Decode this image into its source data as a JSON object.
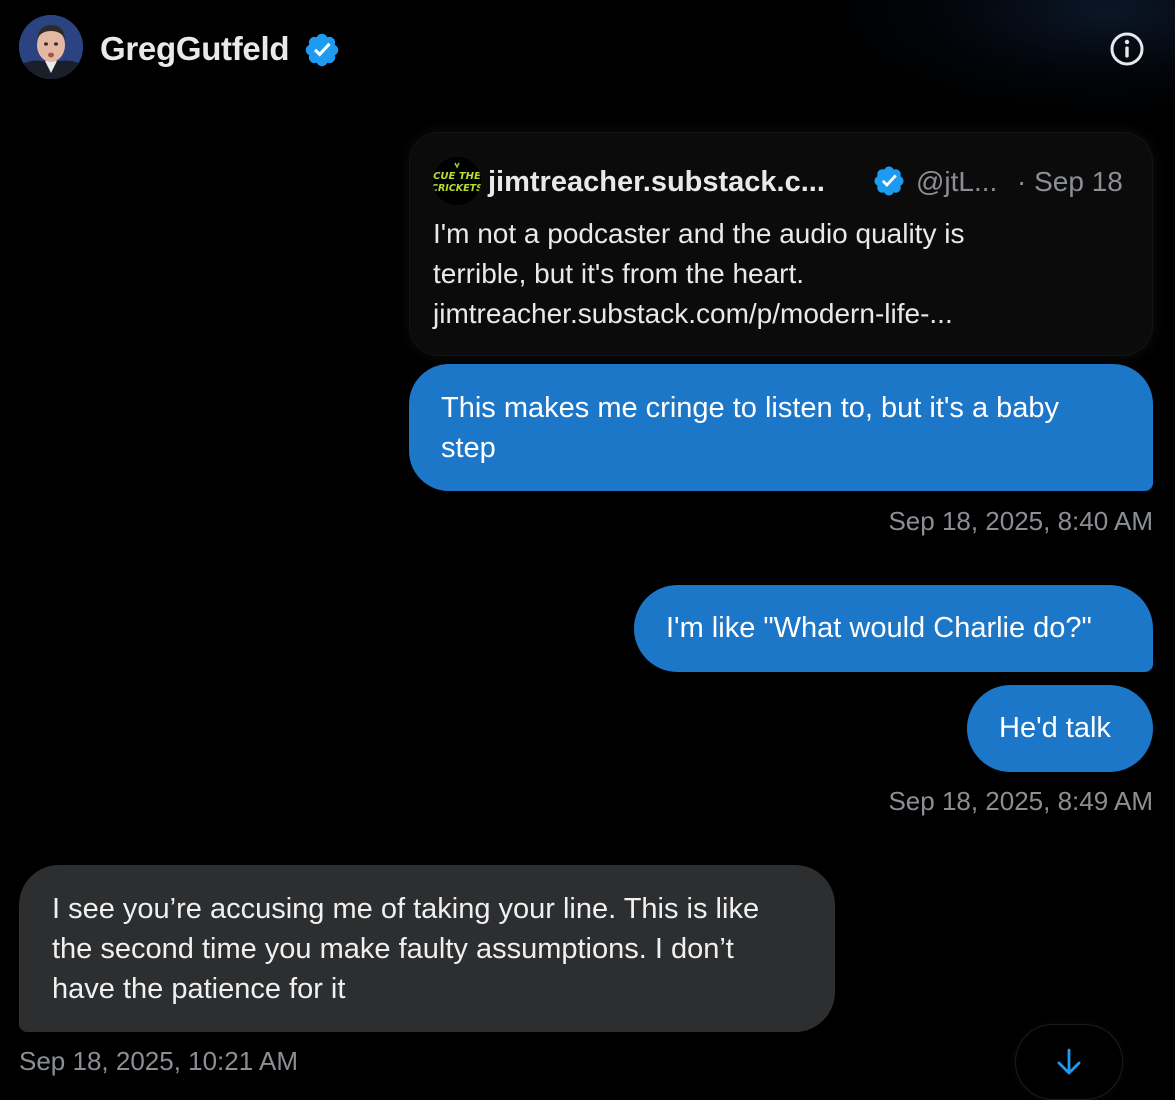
{
  "header": {
    "name": "GregGutfeld",
    "verified_icon": "verified-badge-icon",
    "info_icon": "info-icon"
  },
  "quoted_post": {
    "avatar_text": "CUE THE CRICKETS",
    "name": "jimtreacher.substack.c...",
    "handle": "@jtL...",
    "date": "· Sep 18",
    "text_lines": [
      "I'm not a podcaster and the audio quality is",
      "terrible, but it's from the heart.",
      "jimtreacher.substack.com/p/modern-life-..."
    ]
  },
  "messages": [
    {
      "direction": "out",
      "text_lines": [
        "This makes me cringe to listen to, but it's a baby",
        "step"
      ],
      "timestamp": "Sep 18, 2025, 8:40 AM"
    },
    {
      "direction": "out",
      "text": "I'm like \"What would Charlie do?\""
    },
    {
      "direction": "out",
      "text": "He'd talk",
      "timestamp": "Sep 18, 2025, 8:49 AM"
    },
    {
      "direction": "in",
      "text_lines": [
        "I see you’re accusing me of taking your line. This is like",
        "the second time you make faulty assumptions.  I don’t",
        "have the patience for it"
      ],
      "timestamp": "Sep 18, 2025, 10:21 AM"
    }
  ],
  "scroll_button": {
    "icon": "arrow-down-icon"
  },
  "colors": {
    "background": "#000000",
    "outgoing_bubble": "#1d77c8",
    "incoming_bubble": "#2c2e30",
    "verified": "#1d9bf0",
    "muted_text": "#8b8f94"
  }
}
